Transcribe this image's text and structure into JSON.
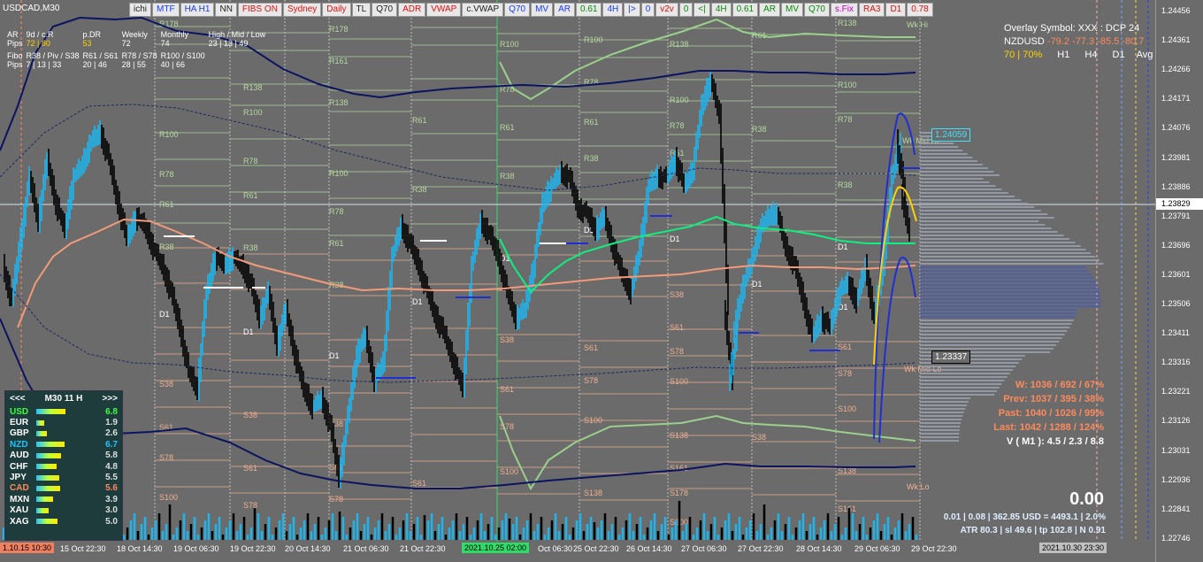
{
  "symbol": "USDCAD,M30",
  "toolbar": [
    "ichi",
    "MTF",
    "HA H1",
    "NN",
    "FIBS ON",
    "Sydney",
    "Daily",
    "TL",
    "Q70",
    "ADR",
    "VWAP",
    "c.VWAP",
    "Q70",
    "MV",
    "AR",
    "0.61",
    "4H",
    "|>",
    "0",
    "v2v",
    "0",
    "<|",
    "4H",
    "0.61",
    "AR",
    "MV",
    "Q70",
    "s.Fix",
    "RA3",
    "D1",
    "0.78"
  ],
  "toolbar_colors": [
    "#222",
    "#1a3cff",
    "#1a3cff",
    "#222",
    "#e01010",
    "#e01010",
    "#e01010",
    "#222",
    "#222",
    "#e01010",
    "#e01010",
    "#222",
    "#1a3cff",
    "#1a3cff",
    "#1a3cff",
    "#0a8a0a",
    "#1a3cff",
    "#1a3cff",
    "#1a3cff",
    "#e01010",
    "#0a8a0a",
    "#0a8a0a",
    "#0a8a0a",
    "#0a8a0a",
    "#0a8a0a",
    "#0a8a0a",
    "#0a8a0a",
    "#c000c0",
    "#e01010",
    "#e01010",
    "#e01010"
  ],
  "stats": {
    "row1": [
      "AR",
      "9d / c.R",
      "p.DR",
      "Weekly",
      "Monthly",
      "High / Mid / Low"
    ],
    "row2": [
      "Pips",
      "72 | 80",
      "53",
      "72",
      "74",
      "23 | 13 | 49"
    ],
    "row3": [
      "Fibo",
      "R38 / Piv / S38",
      "R61 / S61",
      "R78 / S78",
      "R100 / S100"
    ],
    "row4": [
      "Pips",
      "7 | 13 | 33",
      "20 | 46",
      "28 | 55",
      "40 | 66"
    ]
  },
  "strength_panel": {
    "prev": "<<<",
    "title": "M30  11  H",
    "next": ">>>",
    "rows": [
      {
        "cur": "USD",
        "val": "6.8",
        "fill": 0.68,
        "color": "#3cff3c"
      },
      {
        "cur": "EUR",
        "val": "1.9",
        "fill": 0.19,
        "color": "#ffffff"
      },
      {
        "cur": "GBP",
        "val": "2.6",
        "fill": 0.26,
        "color": "#ffffff"
      },
      {
        "cur": "NZD",
        "val": "6.7",
        "fill": 0.67,
        "color": "#22c2ff"
      },
      {
        "cur": "AUD",
        "val": "5.8",
        "fill": 0.58,
        "color": "#ffffff"
      },
      {
        "cur": "CHF",
        "val": "4.8",
        "fill": 0.48,
        "color": "#ffffff"
      },
      {
        "cur": "JPY",
        "val": "5.5",
        "fill": 0.55,
        "color": "#ffffff"
      },
      {
        "cur": "CAD",
        "val": "5.6",
        "fill": 0.56,
        "color": "#ff8a5c"
      },
      {
        "cur": "MXN",
        "val": "3.9",
        "fill": 0.39,
        "color": "#ffffff"
      },
      {
        "cur": "XAU",
        "val": "3.0",
        "fill": 0.3,
        "color": "#ffffff"
      },
      {
        "cur": "XAG",
        "val": "5.0",
        "fill": 0.5,
        "color": "#ffffff"
      }
    ]
  },
  "overlay": {
    "title": "Overlay Symbol: XXX : DCP 24",
    "pair": "NZDUSD",
    "values": "-79.2 -77.3 -85.5 -80.7",
    "pct": "70 | 70%",
    "cols": [
      "H1",
      "H4",
      "D1",
      "Avg"
    ]
  },
  "weekly": {
    "w": "W: 1036 / 692 / 67%",
    "prev": "Prev: 1037 / 395 / 38%",
    "past": "Past: 1040 / 1026 / 99%",
    "last": "Last: 1042 / 1288 / 124%",
    "vol": "V ( M1 ): 4.5 / 2.3 / 8.8"
  },
  "big_value": "0.00",
  "info": {
    "line1": "0.01  |  0.08  |  362.85 USD = 4493.1  |  2.0%",
    "line2": "ATR 80.3  |  sl 49.6  |  tp 102.8  |  N 0.91"
  },
  "price_levels": [
    "1.24456",
    "1.24361",
    "1.24266",
    "1.24171",
    "1.24076",
    "1.23981",
    "1.23886",
    "1.23791",
    "1.23696",
    "1.23601",
    "1.23506",
    "1.23411",
    "1.23316",
    "1.23221",
    "1.23126",
    "1.23031",
    "1.22936",
    "1.22841",
    "1.22746"
  ],
  "current_price": "1.23829",
  "tag_high": "1.24059",
  "tag_low": "1.23337",
  "time_labels": [
    "15 Oct 22:30",
    "18 Oct 14:30",
    "19 Oct 06:30",
    "19 Oct 22:30",
    "20 Oct 14:30",
    "21 Oct 06:30",
    "21 Oct 22:30",
    "2021.10.25 02:00",
    "Oct 06:30",
    "25 Oct 22:30",
    "26 Oct 14:30",
    "27 Oct 06:30",
    "27 Oct 22:30",
    "28 Oct 14:30",
    "29 Oct 06:30",
    "29 Oct 22:30"
  ],
  "time_start": "1.10.15 10:30",
  "time_end": "2021.10.30 23:30",
  "fib_labels": {
    "r": [
      "R178",
      "R161",
      "R138",
      "R100",
      "R78",
      "R61"
    ],
    "s": [
      "S38",
      "S61",
      "S78",
      "S100",
      "S138",
      "S161"
    ],
    "d1": "D1",
    "wk_hi": "Wk Hi",
    "wk_mid_hi": "Wk Mid Hi",
    "wk_mid_lo": "Wk Mid Lo",
    "wk_lo": "Wk Lo"
  },
  "colors": {
    "bull": "#1fb4ec",
    "bear": "#000000",
    "ema": "#f29a7a",
    "vwap": "#10ee80",
    "band": "#9bd08c",
    "navy": "#0c1460"
  }
}
